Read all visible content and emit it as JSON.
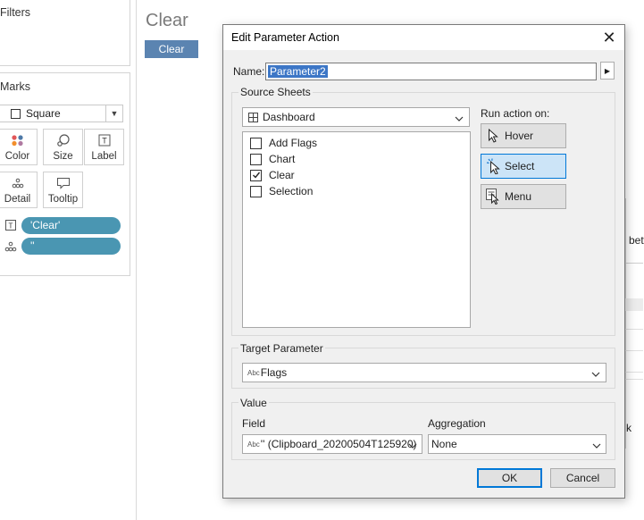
{
  "left_panel": {
    "filters_title": "Filters",
    "marks_title": "Marks",
    "mark_type": "Square",
    "mark_buttons": [
      {
        "label": "Color",
        "icon": "color-dots-icon"
      },
      {
        "label": "Size",
        "icon": "size-icon"
      },
      {
        "label": "Label",
        "icon": "text-label-icon"
      },
      {
        "label": "Detail",
        "icon": "detail-dots-icon"
      },
      {
        "label": "Tooltip",
        "icon": "tooltip-icon"
      }
    ],
    "pills": [
      {
        "text": "'Clear'",
        "icon": "text-label-icon"
      },
      {
        "text": "''",
        "icon": "detail-dots-icon"
      }
    ]
  },
  "dashboard": {
    "title": "Clear",
    "button_label": "Clear"
  },
  "right_peek": {
    "text_a": "betv",
    "text_b": "k"
  },
  "dialog": {
    "title": "Edit Parameter Action",
    "name_label": "Name:",
    "name_value": "Parameter2",
    "source_sheets": {
      "title": "Source Sheets",
      "dashboard_value": "Dashboard",
      "sheets": [
        {
          "label": "Add Flags",
          "checked": false
        },
        {
          "label": "Chart",
          "checked": false
        },
        {
          "label": "Clear",
          "checked": true
        },
        {
          "label": "Selection",
          "checked": false
        }
      ]
    },
    "run_action": {
      "title": "Run action on:",
      "options": [
        {
          "label": "Hover",
          "active": false
        },
        {
          "label": "Select",
          "active": true
        },
        {
          "label": "Menu",
          "active": false
        }
      ]
    },
    "target_parameter": {
      "title": "Target Parameter",
      "type_tag": "Abc",
      "value": "Flags"
    },
    "value_section": {
      "title": "Value",
      "field_label": "Field",
      "field_type_tag": "Abc",
      "field_value": "'' (Clipboard_20200504T125920)",
      "aggregation_label": "Aggregation",
      "aggregation_value": "None"
    },
    "ok_label": "OK",
    "cancel_label": "Cancel"
  },
  "colors": {
    "pill": "#4a96b2",
    "dash_button": "#5b84b1",
    "selection": "#3c76c6",
    "active_button": "#cce4f7"
  }
}
